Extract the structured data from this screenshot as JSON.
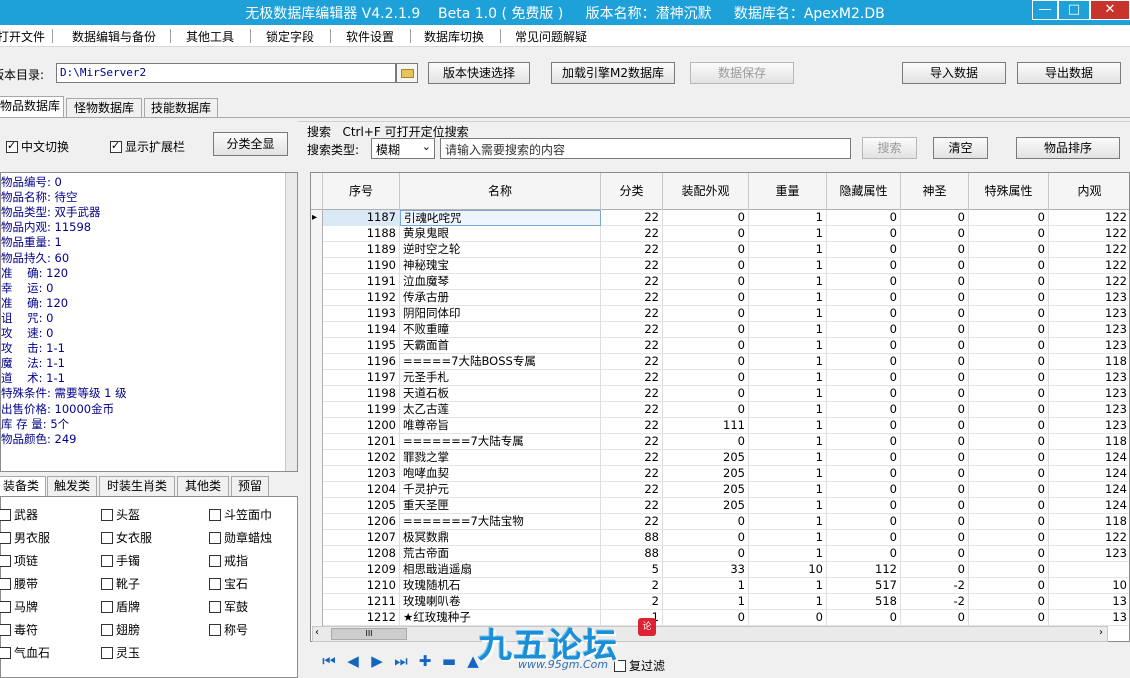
{
  "window": {
    "title": "无极数据库编辑器 V4.2.1.9    Beta 1.0 ( 免费版 )     版本名称：潜神沉默     数据库名：ApexM2.DB",
    "min_label": "—",
    "max_label": "□",
    "close_label": "✕"
  },
  "menu": [
    "打开文件",
    "数据编辑与备份",
    "其他工具",
    "锁定字段",
    "软件设置",
    "数据库切换",
    "常见问题解疑"
  ],
  "toolbar": {
    "dir_label": "版本目录:",
    "dir_value": "D:\\MirServer2",
    "quick_select": "版本快速选择",
    "load_engine": "加载引擎M2数据库",
    "save_data": "数据保存",
    "import_data": "导入数据",
    "export_data": "导出数据"
  },
  "tabs": [
    "物品数据库",
    "怪物数据库",
    "技能数据库"
  ],
  "options": {
    "chinese_switch": "中文切换",
    "show_ext": "显示扩展栏",
    "show_all": "分类全显"
  },
  "search": {
    "hint": "搜索   Ctrl+F 可打开定位搜索",
    "type_label": "搜索类型:",
    "type_value": "模糊",
    "placeholder": "请输入需要搜索的内容",
    "search_btn": "搜索",
    "clear_btn": "清空",
    "sort_btn": "物品排序"
  },
  "item_info": [
    "物品编号: 0",
    "物品名称: 待空",
    "物品类型: 双手武器",
    "物品内观: 11598",
    "物品重量: 1",
    "物品持久: 60",
    "准    确: 120",
    "幸    运: 0",
    "准    确: 120",
    "诅    咒: 0",
    "攻    速: 0",
    "攻    击: 1-1",
    "魔    法: 1-1",
    "道    术: 1-1",
    "特殊条件: 需要等级 1 级",
    "出售价格: 10000金币",
    "库 存 量: 5个",
    "物品颜色: 249"
  ],
  "category_tabs": [
    "装备类",
    "触发类",
    "时装生肖类",
    "其他类",
    "预留"
  ],
  "categories": [
    [
      "武器",
      "头盔",
      "斗笠面巾"
    ],
    [
      "男衣服",
      "女衣服",
      "勋章蜡烛"
    ],
    [
      "项链",
      "手镯",
      "戒指"
    ],
    [
      "腰带",
      "靴子",
      "宝石"
    ],
    [
      "马牌",
      "盾牌",
      "军鼓"
    ],
    [
      "毒符",
      "翅膀",
      "称号"
    ],
    [
      "气血石",
      "灵玉",
      ""
    ]
  ],
  "grid": {
    "columns": [
      "序号",
      "名称",
      "分类",
      "装配外观",
      "重量",
      "隐藏属性",
      "神圣",
      "特殊属性",
      "内观"
    ],
    "rows": [
      [
        "1187",
        "引魂叱咤咒",
        "22",
        "0",
        "1",
        "0",
        "0",
        "0",
        "122"
      ],
      [
        "1188",
        "黄泉鬼眼",
        "22",
        "0",
        "1",
        "0",
        "0",
        "0",
        "122"
      ],
      [
        "1189",
        "逆时空之轮",
        "22",
        "0",
        "1",
        "0",
        "0",
        "0",
        "122"
      ],
      [
        "1190",
        "神秘瑰宝",
        "22",
        "0",
        "1",
        "0",
        "0",
        "0",
        "122"
      ],
      [
        "1191",
        "泣血魔琴",
        "22",
        "0",
        "1",
        "0",
        "0",
        "0",
        "122"
      ],
      [
        "1192",
        "传承古册",
        "22",
        "0",
        "1",
        "0",
        "0",
        "0",
        "123"
      ],
      [
        "1193",
        "阴阳同体印",
        "22",
        "0",
        "1",
        "0",
        "0",
        "0",
        "123"
      ],
      [
        "1194",
        "不败重瞳",
        "22",
        "0",
        "1",
        "0",
        "0",
        "0",
        "123"
      ],
      [
        "1195",
        "天霸面首",
        "22",
        "0",
        "1",
        "0",
        "0",
        "0",
        "123"
      ],
      [
        "1196",
        "=====7大陆BOSS专属",
        "22",
        "0",
        "1",
        "0",
        "0",
        "0",
        "118"
      ],
      [
        "1197",
        "元圣手札",
        "22",
        "0",
        "1",
        "0",
        "0",
        "0",
        "123"
      ],
      [
        "1198",
        "天道石板",
        "22",
        "0",
        "1",
        "0",
        "0",
        "0",
        "123"
      ],
      [
        "1199",
        "太乙古莲",
        "22",
        "0",
        "1",
        "0",
        "0",
        "0",
        "123"
      ],
      [
        "1200",
        "唯尊帝旨",
        "22",
        "111",
        "1",
        "0",
        "0",
        "0",
        "123"
      ],
      [
        "1201",
        "=======7大陆专属",
        "22",
        "0",
        "1",
        "0",
        "0",
        "0",
        "118"
      ],
      [
        "1202",
        "罪戮之掌",
        "22",
        "205",
        "1",
        "0",
        "0",
        "0",
        "124"
      ],
      [
        "1203",
        "咆哮血契",
        "22",
        "205",
        "1",
        "0",
        "0",
        "0",
        "124"
      ],
      [
        "1204",
        "千灵护元",
        "22",
        "205",
        "1",
        "0",
        "0",
        "0",
        "124"
      ],
      [
        "1205",
        "重天圣匣",
        "22",
        "205",
        "1",
        "0",
        "0",
        "0",
        "124"
      ],
      [
        "1206",
        "=======7大陆宝物",
        "22",
        "0",
        "1",
        "0",
        "0",
        "0",
        "118"
      ],
      [
        "1207",
        "极冥数鼎",
        "88",
        "0",
        "1",
        "0",
        "0",
        "0",
        "122"
      ],
      [
        "1208",
        "荒古帝面",
        "88",
        "0",
        "1",
        "0",
        "0",
        "0",
        "123"
      ],
      [
        "1209",
        "相思戢逍遥扇",
        "5",
        "33",
        "10",
        "112",
        "0",
        "0",
        ""
      ],
      [
        "1210",
        "玫瑰随机石",
        "2",
        "1",
        "1",
        "517",
        "-2",
        "0",
        "10"
      ],
      [
        "1211",
        "玫瑰喇叭卷",
        "2",
        "1",
        "1",
        "518",
        "-2",
        "0",
        "13"
      ],
      [
        "1212",
        "★红玫瑰种子",
        "1",
        "0",
        "0",
        "0",
        "0",
        "0",
        "13"
      ]
    ]
  },
  "hscroll_grip": "III",
  "filter_label": "复过滤",
  "watermark": {
    "main": "九五论坛",
    "sub": "www.95gm.Com",
    "seal": "论"
  }
}
